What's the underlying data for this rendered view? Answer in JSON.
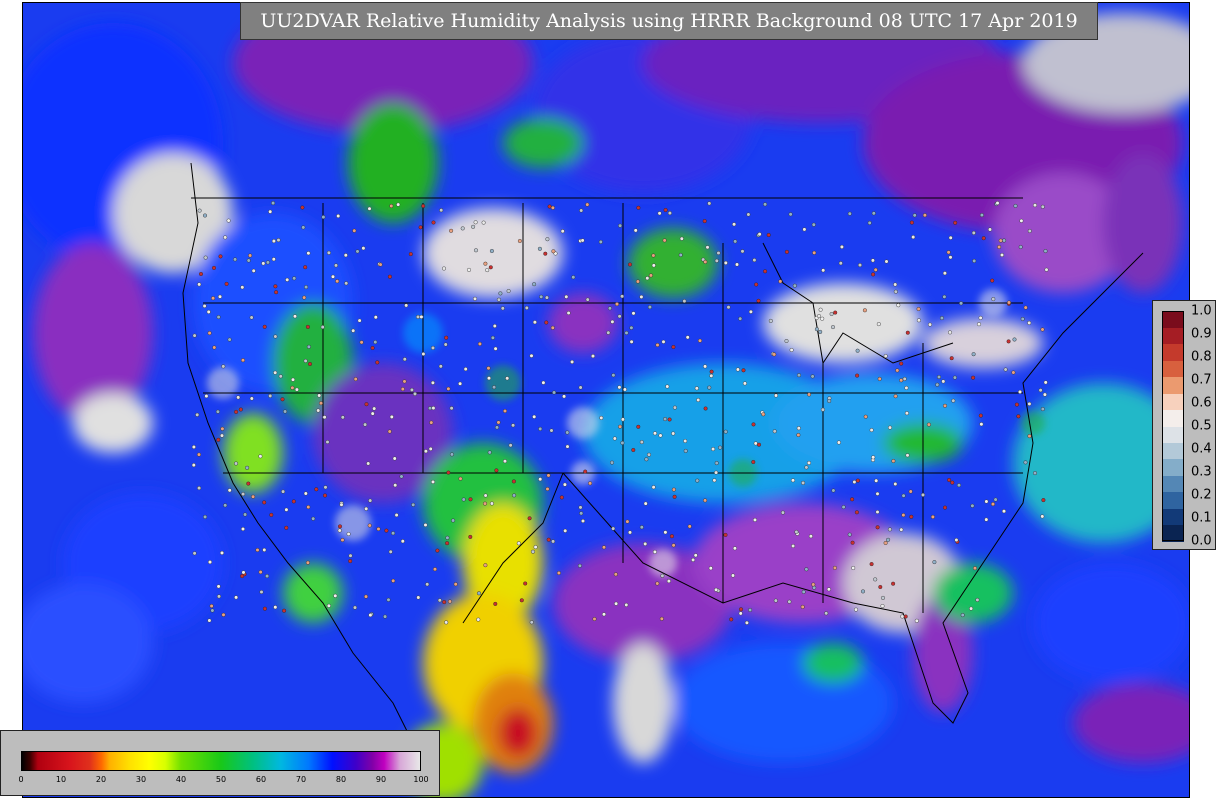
{
  "title": "UU2DVAR Relative Humidity Analysis using HRRR Background 08 UTC 17 Apr 2019",
  "colorbar_bottom": {
    "ticks": [
      "0",
      "10",
      "20",
      "30",
      "40",
      "50",
      "60",
      "70",
      "80",
      "90",
      "100"
    ],
    "range": [
      0,
      100
    ]
  },
  "colorbar_right": {
    "ticks": [
      "1.0",
      "0.9",
      "0.8",
      "0.7",
      "0.6",
      "0.5",
      "0.4",
      "0.3",
      "0.2",
      "0.1",
      "0.0"
    ],
    "colors": [
      "#7a0c1c",
      "#a51d24",
      "#c43a2c",
      "#d8603e",
      "#eb9a6f",
      "#f7d1bd",
      "#f4eeeb",
      "#dde2e7",
      "#b3c9d8",
      "#84adc9",
      "#5487b5",
      "#2f64a0",
      "#123a78",
      "#0a2452"
    ],
    "range": [
      0.0,
      1.0
    ]
  },
  "palette": {
    "ocean_dry": "#1a40ff",
    "humid": "#7a1fb0",
    "saturated": "#d8d8d8",
    "moderate": "#10b010",
    "dry": "#ffe000",
    "very_dry": "#d0101c"
  }
}
